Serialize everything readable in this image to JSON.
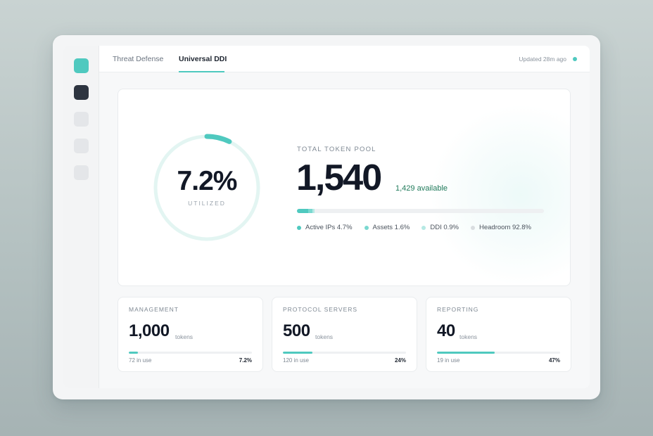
{
  "tabs": [
    {
      "label": "Threat Defense",
      "active": false
    },
    {
      "label": "Universal DDI",
      "active": true
    }
  ],
  "status": {
    "updated_text": "Updated 28m ago",
    "live_color": "#4fc9bf"
  },
  "utilization": {
    "value_text": "7.2%",
    "label": "UTILIZED",
    "fraction": 0.072
  },
  "pool": {
    "label": "TOTAL TOKEN POOL",
    "value": "1,540",
    "available": "1,429 available",
    "breakdown": [
      {
        "label": "Active IPs 4.7%",
        "percent": 4.7,
        "color": "#4fc9bf"
      },
      {
        "label": "Assets 1.6%",
        "percent": 1.6,
        "color": "#7ad8d0"
      },
      {
        "label": "DDI 0.9%",
        "percent": 0.9,
        "color": "#b6e9e4"
      },
      {
        "label": "Headroom 92.8%",
        "percent": 92.8,
        "color": "#e2e5e8"
      }
    ]
  },
  "cards": [
    {
      "title": "MANAGEMENT",
      "value": "1,000",
      "unit": "tokens",
      "in_use": "72 in use",
      "percent_text": "7.2%",
      "fraction": 0.072
    },
    {
      "title": "PROTOCOL SERVERS",
      "value": "500",
      "unit": "tokens",
      "in_use": "120 in use",
      "percent_text": "24%",
      "fraction": 0.24
    },
    {
      "title": "REPORTING",
      "value": "40",
      "unit": "tokens",
      "in_use": "19 in use",
      "percent_text": "47%",
      "fraction": 0.47
    }
  ],
  "colors": {
    "accent": "#4fc9bf",
    "dark": "#121826",
    "available_green": "#1f7a5a"
  }
}
